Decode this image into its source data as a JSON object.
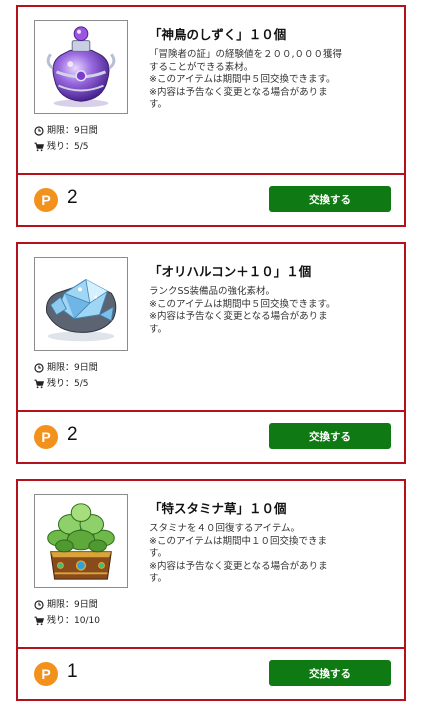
{
  "items": [
    {
      "title": "「神鳥のしずく」１０個",
      "description": "「冒険者の証」の経験値を２００,０００獲得\nすることができる素材。\n※このアイテムは期間中５回交換できます。\n※内容は予告なく変更となる場合がありま\nす。",
      "period": "期限：9日間",
      "stock": "残り：5/5",
      "points": "2",
      "point_icon": "P",
      "button_label": "交換する",
      "image_icon": "purple-potion-bottle-icon"
    },
    {
      "title": "「オリハルコン＋１０」１個",
      "description": "ランクSS装備品の強化素材。\n※このアイテムは期間中５回交換できます。\n※内容は予告なく変更となる場合がありま\nす。",
      "period": "期限：9日間",
      "stock": "残り：5/5",
      "points": "2",
      "point_icon": "P",
      "button_label": "交換する",
      "image_icon": "blue-crystal-ore-icon"
    },
    {
      "title": "「特スタミナ草」１０個",
      "description": "スタミナを４０回復するアイテム。\n※このアイテムは期間中１０回交換できま\nす。\n※内容は予告なく変更となる場合がありま\nす。",
      "period": "期限：9日間",
      "stock": "残り：10/10",
      "points": "1",
      "point_icon": "P",
      "button_label": "交換する",
      "image_icon": "potted-green-herb-icon"
    }
  ],
  "colors": {
    "card_border": "#b3121c",
    "button": "#0f7a13",
    "point_coin": "#f2921c"
  }
}
